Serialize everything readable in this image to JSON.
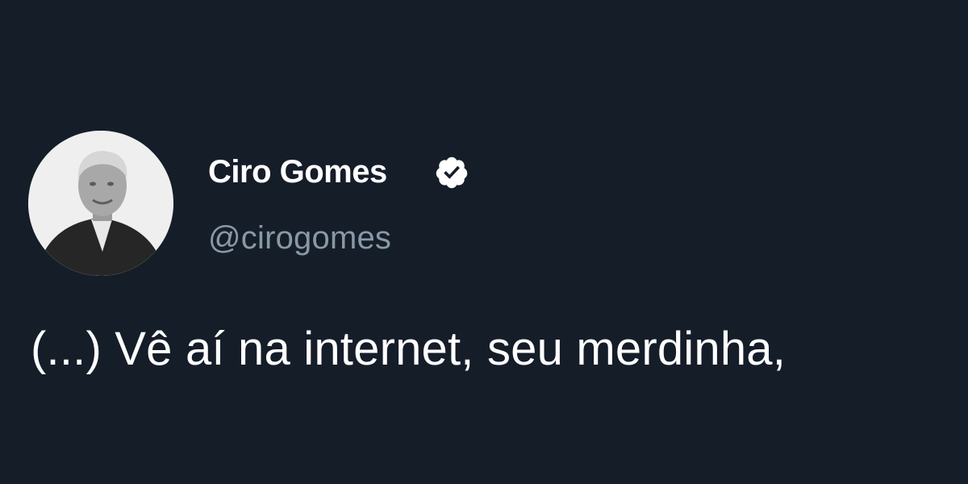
{
  "colors": {
    "background": "#151d29",
    "name_text": "#ffffff",
    "handle_text": "#8899a6",
    "body_text": "#ffffff",
    "verified_badge": "#ffffff"
  },
  "author": {
    "display_name": "Ciro Gomes",
    "handle": "@cirogomes",
    "verified_icon": "verified-badge-icon",
    "avatar_icon": "profile-photo"
  },
  "tweet": {
    "text": "(...) Vê aí na internet, seu merdinha,"
  }
}
